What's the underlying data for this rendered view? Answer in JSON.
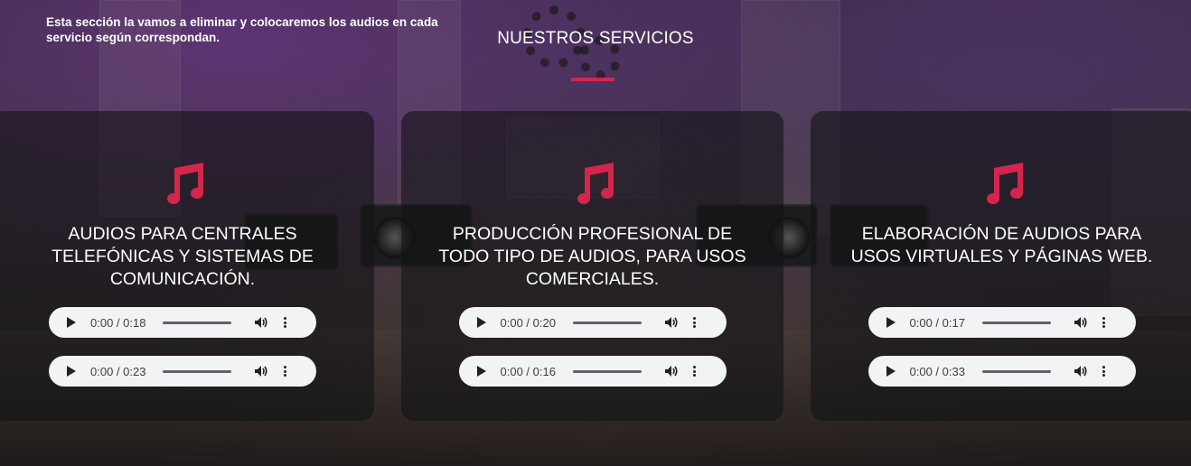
{
  "note": "Esta sección la vamos a eliminar y colocaremos los audios en cada servicio según correspondan.",
  "section_title": "NUESTROS SERVICIOS",
  "colors": {
    "accent": "#d3264c",
    "player_bg": "#f1f3f4",
    "text": "#ffffff"
  },
  "services": [
    {
      "icon": "music-note-icon",
      "title": "AUDIOS PARA CENTRALES TELEFÓNICAS Y SISTEMAS DE COMUNICACIÓN.",
      "audios": [
        {
          "time": "0:00 / 0:18"
        },
        {
          "time": "0:00 / 0:23"
        }
      ]
    },
    {
      "icon": "music-note-icon",
      "title": "PRODUCCIÓN PROFESIONAL DE TODO TIPO DE AUDIOS, PARA USOS COMERCIALES.",
      "audios": [
        {
          "time": "0:00 / 0:20"
        },
        {
          "time": "0:00 / 0:16"
        }
      ]
    },
    {
      "icon": "music-note-icon",
      "title": "ELABORACIÓN DE AUDIOS PARA USOS VIRTUALES Y PÁGINAS WEB.",
      "audios": [
        {
          "time": "0:00 / 0:17"
        },
        {
          "time": "0:00 / 0:33"
        }
      ]
    }
  ]
}
